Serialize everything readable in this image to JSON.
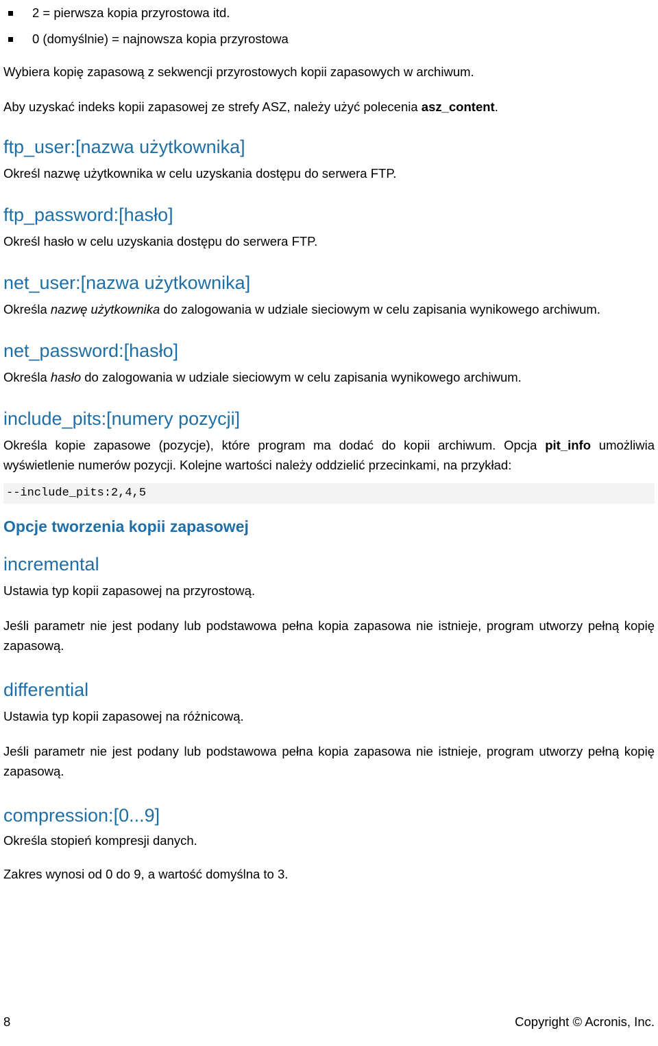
{
  "document": {
    "language": "pl",
    "accent_color": "#1F6FA6",
    "body_color": "#000000",
    "code_block_bg": "#F3F3F3"
  },
  "top_bullets": [
    {
      "text": "2 = pierwsza kopia przyrostowa itd."
    },
    {
      "text": "0 (domyślnie) = najnowsza kopia przyrostowa"
    }
  ],
  "intro_paragraphs": [
    {
      "text": "Wybiera kopię zapasową z sekwencji przyrostowych kopii zapasowych w archiwum."
    }
  ],
  "asz_paragraph": {
    "lead": "Aby uzyskać indeks kopii zapasowej ze strefy ASZ, należy użyć polecenia ",
    "bold": "asz_content",
    "tail": "."
  },
  "params": [
    {
      "heading": "ftp_user:[nazwa użytkownika]",
      "body": "Określ nazwę użytkownika w celu uzyskania dostępu do serwera FTP."
    },
    {
      "heading": "ftp_password:[hasło]",
      "body": "Określ hasło w celu uzyskania dostępu do serwera FTP."
    },
    {
      "heading": "net_user:[nazwa użytkownika]",
      "body_pre": "Określa ",
      "body_italic": "nazwę użytkownika",
      "body_post": " do zalogowania w udziale sieciowym w celu zapisania wynikowego archiwum."
    },
    {
      "heading": "net_password:[hasło]",
      "body_pre": "Określa ",
      "body_italic": "hasło",
      "body_post": " do zalogowania w udziale sieciowym w celu zapisania wynikowego archiwum."
    },
    {
      "heading": "include_pits:[numery pozycji]",
      "body_pre": "Określa kopie zapasowe (pozycje), które program ma dodać do kopii archiwum. Opcja ",
      "body_bold": "pit_info",
      "body_post": " umożliwia wyświetlenie numerów pozycji. Kolejne wartości należy oddzielić przecinkami, na przykład:",
      "code": "--include_pits:2,4,5"
    }
  ],
  "section_backup_options": {
    "heading": "Opcje tworzenia kopii zapasowej",
    "params": [
      {
        "heading": "incremental",
        "body1": "Ustawia typ kopii zapasowej na przyrostową.",
        "body2": "Jeśli parametr nie jest podany lub podstawowa pełna kopia zapasowa nie istnieje, program utworzy pełną kopię zapasową."
      },
      {
        "heading": "differential",
        "body1": "Ustawia typ kopii zapasowej na różnicową.",
        "body2": "Jeśli parametr nie jest podany lub podstawowa pełna kopia zapasowa nie istnieje, program utworzy pełną kopię zapasową."
      },
      {
        "heading": "compression:[0...9]",
        "body1": "Określa stopień kompresji danych.",
        "body2": "Zakres wynosi od 0 do 9, a wartość domyślna to 3."
      }
    ]
  },
  "footer": {
    "page_number": "8",
    "copyright": "Copyright © Acronis, Inc."
  }
}
